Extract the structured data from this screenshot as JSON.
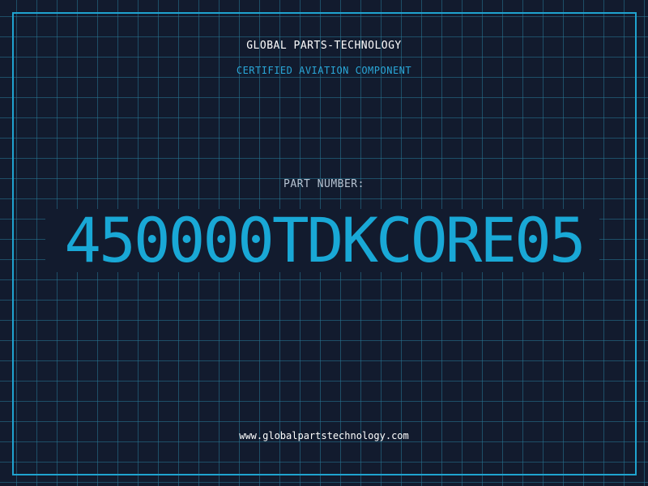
{
  "header": {
    "company": "GLOBAL PARTS-TECHNOLOGY",
    "subtitle": "CERTIFIED AVIATION COMPONENT"
  },
  "part": {
    "label": "PART NUMBER:",
    "number": "450000TDKCORE05"
  },
  "footer": {
    "url": "www.globalpartstechnology.com"
  },
  "colors": {
    "background": "#121b2e",
    "grid": "#28789a",
    "accent": "#1fa3cf",
    "part_number": "#19a8d6"
  }
}
